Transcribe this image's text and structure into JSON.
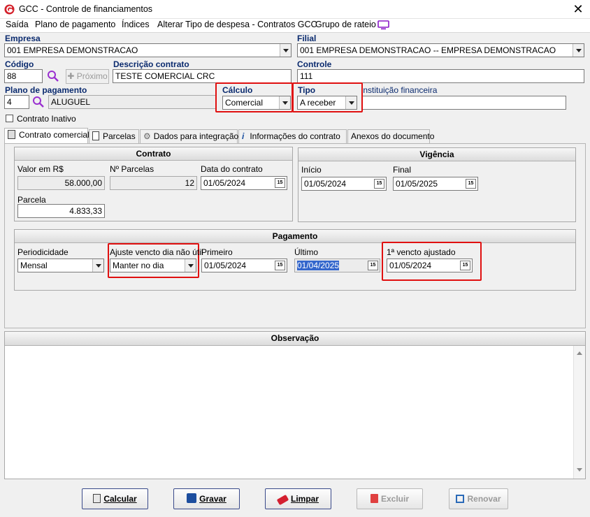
{
  "window": {
    "title": "GCC - Controle de financiamentos"
  },
  "menu": {
    "items": [
      "Saída",
      "Plano de pagamento",
      "Índices",
      "Alterar Tipo de despesa - Contratos GCC",
      "Grupo de rateio"
    ]
  },
  "header": {
    "empresa_label": "Empresa",
    "empresa_value": "001 EMPRESA DEMONSTRACAO",
    "filial_label": "Filial",
    "filial_value": "001 EMPRESA DEMONSTRACAO -- EMPRESA DEMONSTRACAO",
    "codigo_label": "Código",
    "codigo_value": "88",
    "proximo_label": "Próximo",
    "descricao_label": "Descrição contrato",
    "descricao_value": "TESTE COMERCIAL CRC",
    "controle_label": "Controle",
    "controle_value": "111",
    "plano_label": "Plano de pagamento",
    "plano_code": "4",
    "plano_value": "ALUGUEL",
    "calculo_label": "Cálculo",
    "calculo_value": "Comercial",
    "tipo_label": "Tipo",
    "tipo_value": "A receber",
    "instituicao_label": "Instituição financeira",
    "instituicao_value": "",
    "inativo_label": "Contrato Inativo"
  },
  "tabs": [
    "Contrato comercial",
    "Parcelas",
    "Dados para integração",
    "Informações do contrato",
    "Anexos do documento"
  ],
  "contrato": {
    "title": "Contrato",
    "valor_label": "Valor em R$",
    "valor_value": "58.000,00",
    "nparcelas_label": "Nº Parcelas",
    "nparcelas_value": "12",
    "data_label": "Data do contrato",
    "data_value": "01/05/2024",
    "parcela_label": "Parcela",
    "parcela_value": "4.833,33"
  },
  "vigencia": {
    "title": "Vigência",
    "inicio_label": "Início",
    "inicio_value": "01/05/2024",
    "final_label": "Final",
    "final_value": "01/05/2025"
  },
  "pagamento": {
    "title": "Pagamento",
    "periodicidade_label": "Periodicidade",
    "periodicidade_value": "Mensal",
    "ajuste_label": "Ajuste vencto dia não útil",
    "ajuste_value": "Manter no dia",
    "primeiro_label": "Primeiro",
    "primeiro_value": "01/05/2024",
    "ultimo_label": "Último",
    "ultimo_value": "01/04/2025",
    "ajustado_label": "1ª vencto ajustado",
    "ajustado_value": "01/05/2024"
  },
  "observacao": {
    "title": "Observação"
  },
  "calendar_glyph": "15",
  "buttons": {
    "calcular": "Calcular",
    "gravar": "Gravar",
    "limpar": "Limpar",
    "excluir": "Excluir",
    "renovar": "Renovar"
  }
}
